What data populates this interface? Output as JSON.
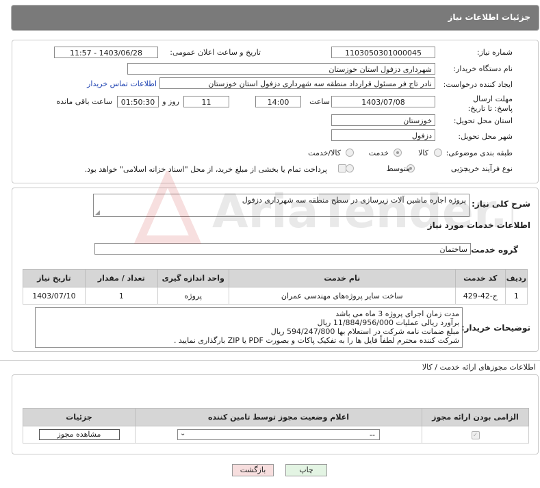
{
  "header": {
    "title": "جزئیات اطلاعات نیاز"
  },
  "form": {
    "need_number_label": "شماره نیاز:",
    "need_number": "1103050301000045",
    "announce_label": "تاریخ و ساعت اعلان عمومی:",
    "announce_value": "1403/06/28 - 11:57",
    "buyer_org_label": "نام دستگاه خریدار:",
    "buyer_org": "شهرداری دزفول استان خوزستان",
    "creator_label": "ایجاد کننده درخواست:",
    "creator": "نادر تاج فر مسئول قرارداد منطقه سه شهرداری دزفول استان خوزستان",
    "contact_link": "اطلاعات تماس خریدار",
    "deadline_label": "مهلت ارسال پاسخ: تا تاریخ:",
    "deadline_date": "1403/07/08",
    "time_label": "ساعت",
    "deadline_time": "14:00",
    "days": "11",
    "days_label": "روز و",
    "remaining_time": "01:50:30",
    "remaining_label": "ساعت باقی مانده",
    "province_label": "استان محل تحویل:",
    "province": "خوزستان",
    "city_label": "شهر محل تحویل:",
    "city": "دزفول",
    "category_label": "طبقه بندی موضوعی:",
    "category_options": [
      "کالا",
      "خدمت",
      "کالا/خدمت"
    ],
    "category_selected": "خدمت",
    "process_label": "نوع فرآیند خرید :",
    "process_options": [
      "جزیی",
      "متوسط"
    ],
    "process_selected": "جزیی",
    "payment_note": "پرداخت تمام یا بخشی از مبلغ خرید، از محل \"اسناد خزانه اسلامی\" خواهد بود."
  },
  "summary": {
    "label": "شرح کلی نیاز:",
    "text": "پروژه اجاره ماشین آلات زیرسازی در سطح منطقه سه شهرداری دزفول"
  },
  "services": {
    "section_title": "اطلاعات خدمات مورد نیاز",
    "group_label": "گروه خدمت:",
    "group_value": "ساختمان",
    "columns": [
      "ردیف",
      "کد خدمت",
      "نام خدمت",
      "واحد اندازه گیری",
      "تعداد / مقدار",
      "تاریخ نیاز"
    ],
    "rows": [
      [
        "1",
        "ج-42-429",
        "ساخت سایر پروژه‌های مهندسی عمران",
        "پروژه",
        "1",
        "1403/07/10"
      ]
    ]
  },
  "buyer_notes": {
    "label": "توضیحات خریدار:",
    "lines": [
      "مدت زمان اجرای پروژه 3 ماه می باشد",
      "برآورد ریالی عملیات 11/884/956/000 ریال",
      "مبلغ ضمانت نامه شرکت در استعلام بها 594/247/800 ریال",
      "شرکت کننده محترم لطفاً فایل ها را به تفکیک پاکات و بصورت PDF یا ZIP بارگذاری نمایید ."
    ]
  },
  "permits": {
    "section_title": "اطلاعات مجوزهای ارائه خدمت / کالا",
    "columns": [
      "الزامی بودن ارائه مجوز",
      "اعلام وضعیت مجوز توسط تامین کننده",
      "جزئیات"
    ],
    "select_value": "--",
    "view_button": "مشاهده مجوز"
  },
  "footer": {
    "print_button": "چاپ",
    "back_button": "بازگشت"
  },
  "watermark": {
    "text": "AriaTender.neT"
  },
  "colors": {
    "titlebar": "#7a7a7a",
    "link": "#1a3fb0",
    "back_button_bg": "#f7dede",
    "print_button_bg": "#e3f4e3"
  }
}
